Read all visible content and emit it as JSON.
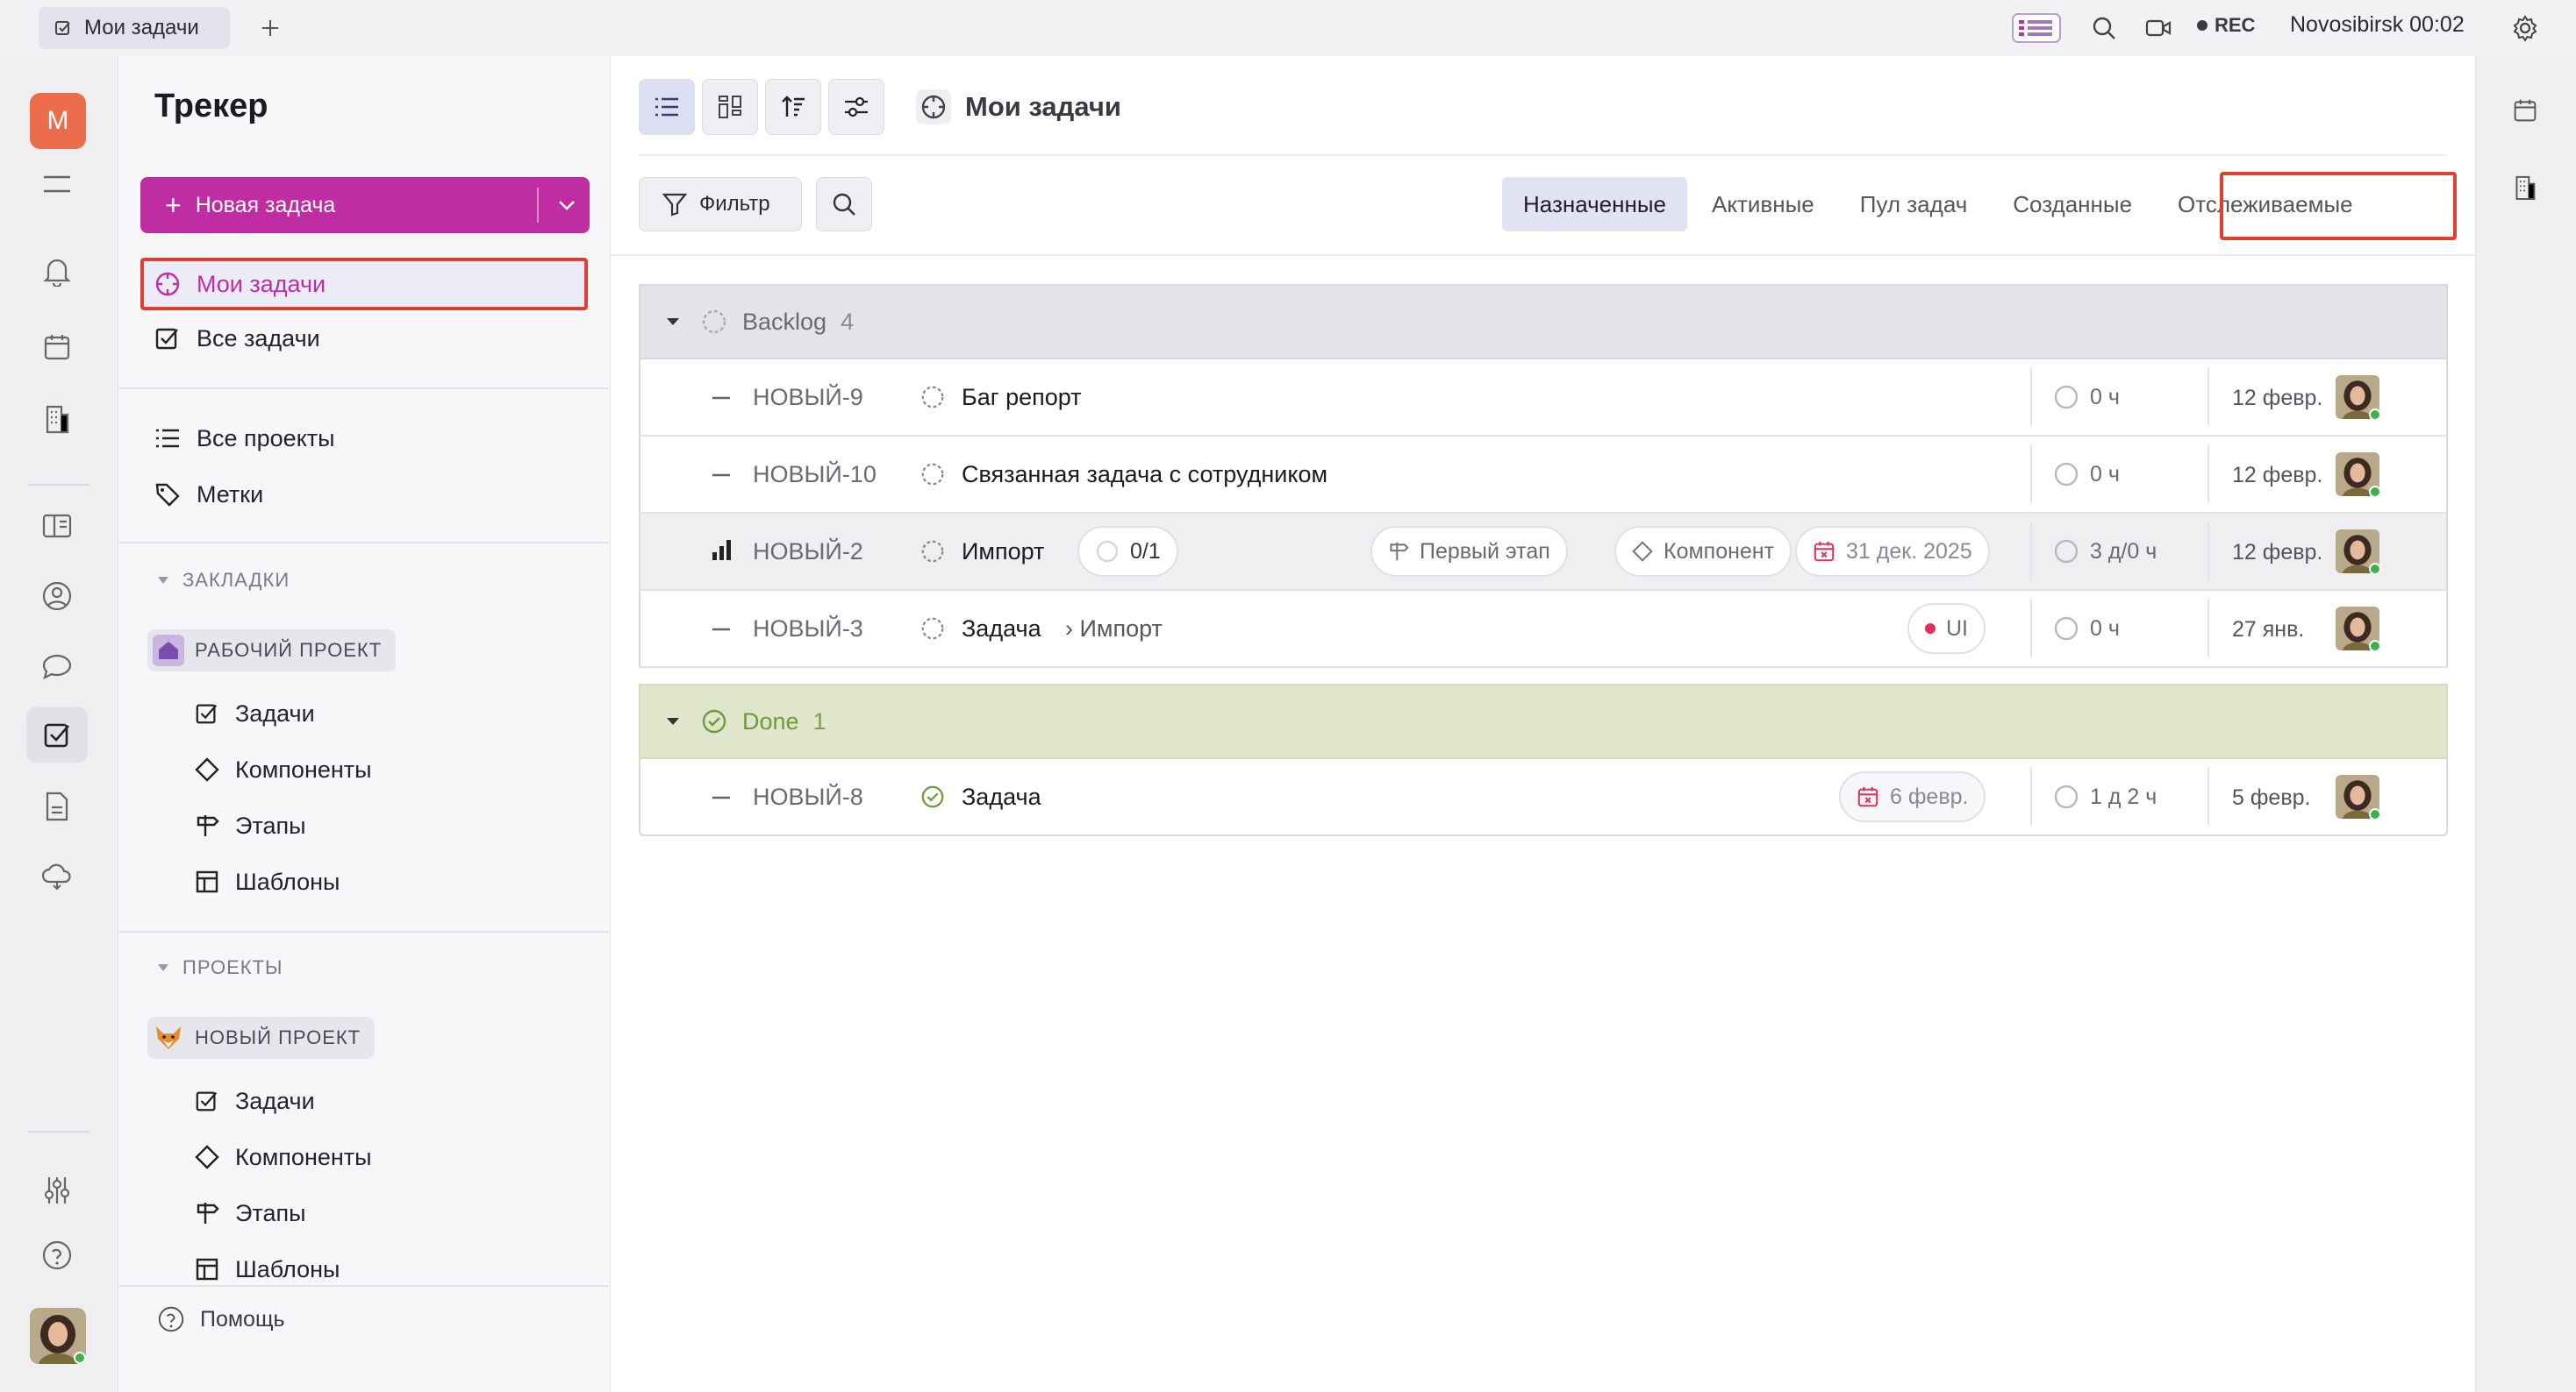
{
  "window": {
    "tab_title": "Мои задачи",
    "rec_label": "REC",
    "location": "Novosibirsk",
    "time": "00:02"
  },
  "rail": {
    "workspace_letter": "M"
  },
  "sidebar": {
    "title": "Трекер",
    "new_task_label": "Новая задача",
    "nav": [
      {
        "label": "Мои задачи"
      },
      {
        "label": "Все задачи"
      },
      {
        "label": "Все проекты"
      },
      {
        "label": "Метки"
      }
    ],
    "bookmarks_header": "ЗАКЛАДКИ",
    "bookmark_project": {
      "name": "РАБОЧИЙ ПРОЕКТ",
      "items": [
        "Задачи",
        "Компоненты",
        "Этапы",
        "Шаблоны"
      ]
    },
    "projects_header": "ПРОЕКТЫ",
    "project": {
      "name": "НОВЫЙ ПРОЕКТ",
      "items": [
        "Задачи",
        "Компоненты",
        "Этапы",
        "Шаблоны"
      ]
    },
    "help_label": "Помощь"
  },
  "main": {
    "title": "Мои задачи",
    "filter_label": "Фильтр",
    "view_tabs": [
      "Назначенные",
      "Активные",
      "Пул задач",
      "Созданные",
      "Отслеживаемые"
    ],
    "selected_view": "Назначенные"
  },
  "groups": [
    {
      "name": "Backlog",
      "count": "4",
      "tasks": [
        {
          "id": "НОВЫЙ-9",
          "title": "Баг репорт",
          "estimate": "0 ч",
          "date": "12 февр."
        },
        {
          "id": "НОВЫЙ-10",
          "title": "Связанная задача с сотрудником",
          "estimate": "0 ч",
          "date": "12 февр."
        },
        {
          "id": "НОВЫЙ-2",
          "title": "Импорт",
          "subtasks": "0/1",
          "milestone": "Первый этап",
          "component": "Компонент",
          "due": "31 дек. 2025",
          "estimate": "3 д/0 ч",
          "date": "12 февр."
        },
        {
          "id": "НОВЫЙ-3",
          "title": "Задача",
          "parent": "› Импорт",
          "label": "UI",
          "estimate": "0 ч",
          "date": "27 янв."
        }
      ]
    },
    {
      "name": "Done",
      "count": "1",
      "tasks": [
        {
          "id": "НОВЫЙ-8",
          "title": "Задача",
          "due": "6 февр.",
          "estimate": "1 д 2 ч",
          "date": "5 февр."
        }
      ]
    }
  ],
  "colors": {
    "accent": "#c02da3",
    "highlight_border": "#e0402f",
    "done_green": "#6f9a37",
    "label_red": "#e0305a"
  }
}
